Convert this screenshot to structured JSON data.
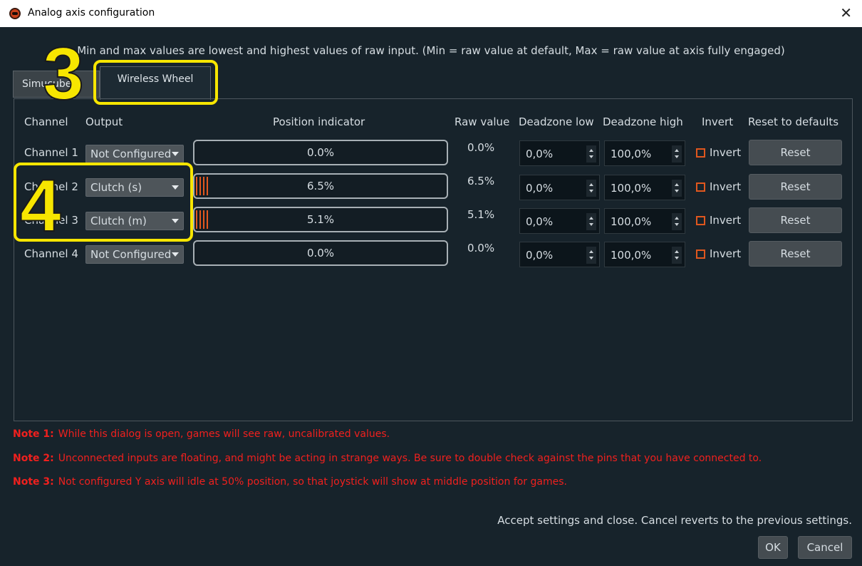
{
  "window": {
    "title": "Analog axis configuration",
    "close_glyph": "✕"
  },
  "info_line": "Min and max values are lowest and highest values of raw input. (Min = raw value at default, Max = raw value at axis fully engaged)",
  "tabs": [
    {
      "label": "Simucube 2",
      "active": false
    },
    {
      "label": "Wireless Wheel",
      "active": true
    }
  ],
  "headers": {
    "channel": "Channel",
    "output": "Output",
    "position": "Position indicator",
    "raw": "Raw value",
    "dz_low": "Deadzone low",
    "dz_high": "Deadzone high",
    "invert": "Invert",
    "reset": "Reset to defaults"
  },
  "rows": [
    {
      "channel": "Channel 1",
      "output": "Not Configured",
      "position_text": "0.0%",
      "position_fraction": 0.0,
      "raw": "0.0%",
      "dz_low": "0,0%",
      "dz_high": "100,0%",
      "invert_label": "Invert",
      "inverted": false,
      "reset_label": "Reset"
    },
    {
      "channel": "Channel 2",
      "output": "Clutch (s)",
      "position_text": "6.5%",
      "position_fraction": 0.065,
      "raw": "6.5%",
      "dz_low": "0,0%",
      "dz_high": "100,0%",
      "invert_label": "Invert",
      "inverted": false,
      "reset_label": "Reset"
    },
    {
      "channel": "Channel 3",
      "output": "Clutch (m)",
      "position_text": "5.1%",
      "position_fraction": 0.051,
      "raw": "5.1%",
      "dz_low": "0,0%",
      "dz_high": "100,0%",
      "invert_label": "Invert",
      "inverted": false,
      "reset_label": "Reset"
    },
    {
      "channel": "Channel 4",
      "output": "Not Configured",
      "position_text": "0.0%",
      "position_fraction": 0.0,
      "raw": "0.0%",
      "dz_low": "0,0%",
      "dz_high": "100,0%",
      "invert_label": "Invert",
      "inverted": false,
      "reset_label": "Reset"
    }
  ],
  "notes": [
    {
      "label": "Note 1:",
      "text": "While this dialog is open, games will see raw, uncalibrated values."
    },
    {
      "label": "Note 2:",
      "text": "Unconnected inputs are floating, and might be acting in strange ways. Be sure to double check against the pins that you have connected to."
    },
    {
      "label": "Note 3:",
      "text": "Not configured Y axis will idle at 50% position, so that joystick will show at middle position for games."
    }
  ],
  "footer": {
    "text": "Accept settings and close. Cancel reverts to the previous settings.",
    "ok_label": "OK",
    "cancel_label": "Cancel"
  },
  "annotations": {
    "step_3": "3",
    "step_4": "4"
  },
  "colors": {
    "background": "#17232b",
    "text": "#d6dde2",
    "accent_orange": "#e2571f",
    "note_red": "#f0201e",
    "annotation_yellow": "#f7e600"
  }
}
